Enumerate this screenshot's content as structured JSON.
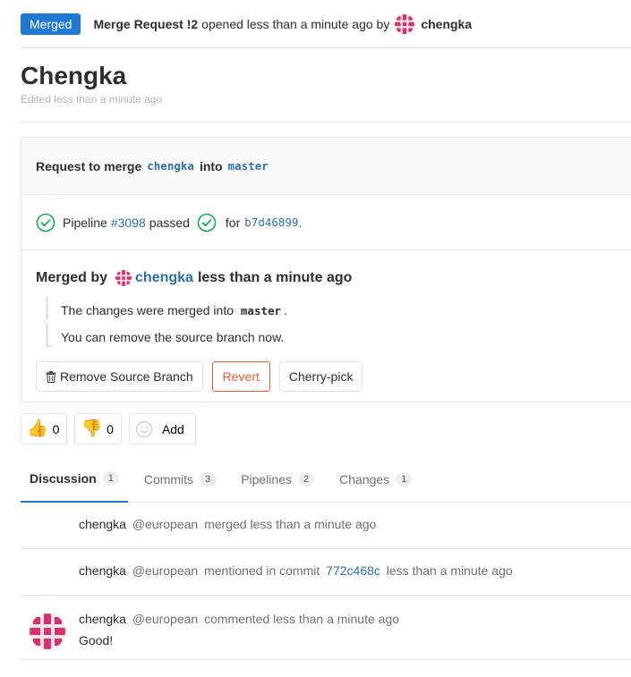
{
  "header": {
    "status": "Merged",
    "title": "Merge Request !2",
    "opened_text": "opened less than a minute ago by",
    "author": "chengka"
  },
  "issue": {
    "title": "Chengka",
    "edited": "Edited less than a minute ago"
  },
  "widget": {
    "request_label": "Request to merge",
    "source_branch": "chengka",
    "into_label": "into",
    "target_branch": "master",
    "pipeline_label": "Pipeline",
    "pipeline_id": "#3098",
    "pipeline_status": "passed",
    "for_label": "for",
    "commit_sha": "b7d46899",
    "period": ".",
    "merged_by_label": "Merged by",
    "merged_by_user": "chengka",
    "merged_time": "less than a minute ago",
    "merged_msg_prefix": "The changes were merged into",
    "merged_msg_branch": "master",
    "merged_msg_suffix": ".",
    "remove_msg": "You can remove the source branch now.",
    "remove_button": "Remove Source Branch",
    "revert_button": "Revert",
    "cherry_pick_button": "Cherry-pick"
  },
  "awards": {
    "thumbsup_count": "0",
    "thumbsdown_count": "0",
    "add_label": "Add"
  },
  "tabs": [
    {
      "label": "Discussion",
      "count": "1"
    },
    {
      "label": "Commits",
      "count": "3"
    },
    {
      "label": "Pipelines",
      "count": "2"
    },
    {
      "label": "Changes",
      "count": "1"
    }
  ],
  "notes": [
    {
      "author": "chengka",
      "handle": "@european",
      "text": "merged less than a minute ago"
    },
    {
      "author": "chengka",
      "handle": "@european",
      "text": "mentioned in commit",
      "commit": "772c468c",
      "time": "less than a minute ago"
    },
    {
      "author": "chengka",
      "handle": "@european",
      "text": "commented less than a minute ago",
      "body": "Good!"
    }
  ],
  "colors": {
    "merged_badge": "#1f78d1",
    "link": "#2f6fa8",
    "success": "#1aaa55",
    "revert": "#e75e40",
    "avatar": "#d6336c"
  },
  "icons": {
    "pipeline_status": "check-circle-icon",
    "remove_branch": "trash-icon",
    "thumbsup": "thumbsup-emoji-icon",
    "thumbsdown": "thumbsdown-emoji-icon",
    "add_award": "smiley-icon"
  }
}
